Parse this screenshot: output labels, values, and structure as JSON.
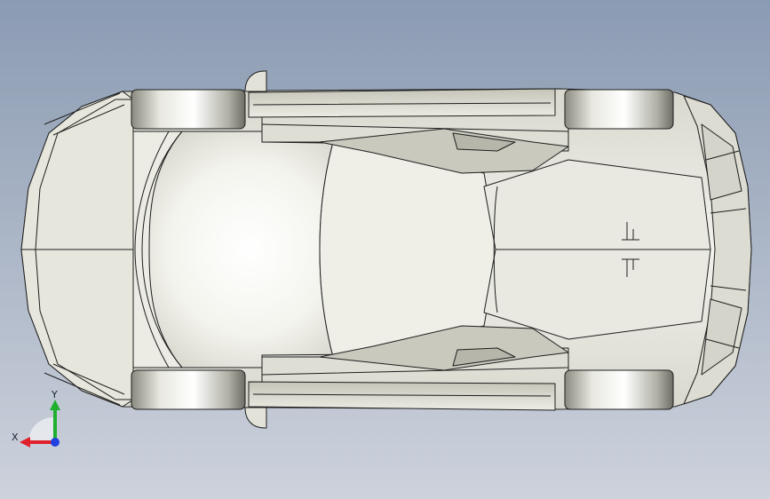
{
  "view": {
    "colors": {
      "background_top": "#8b9bb3",
      "background_bottom": "#cdd2dc",
      "model_surface": "#efefe8",
      "model_shadow": "#c8c8bc",
      "edge": "#1e1e1e"
    }
  },
  "triad": {
    "x_label": "X",
    "y_label": "Y",
    "x_color": "#e0202a",
    "y_color": "#20b030",
    "z_color": "#2040e0"
  }
}
